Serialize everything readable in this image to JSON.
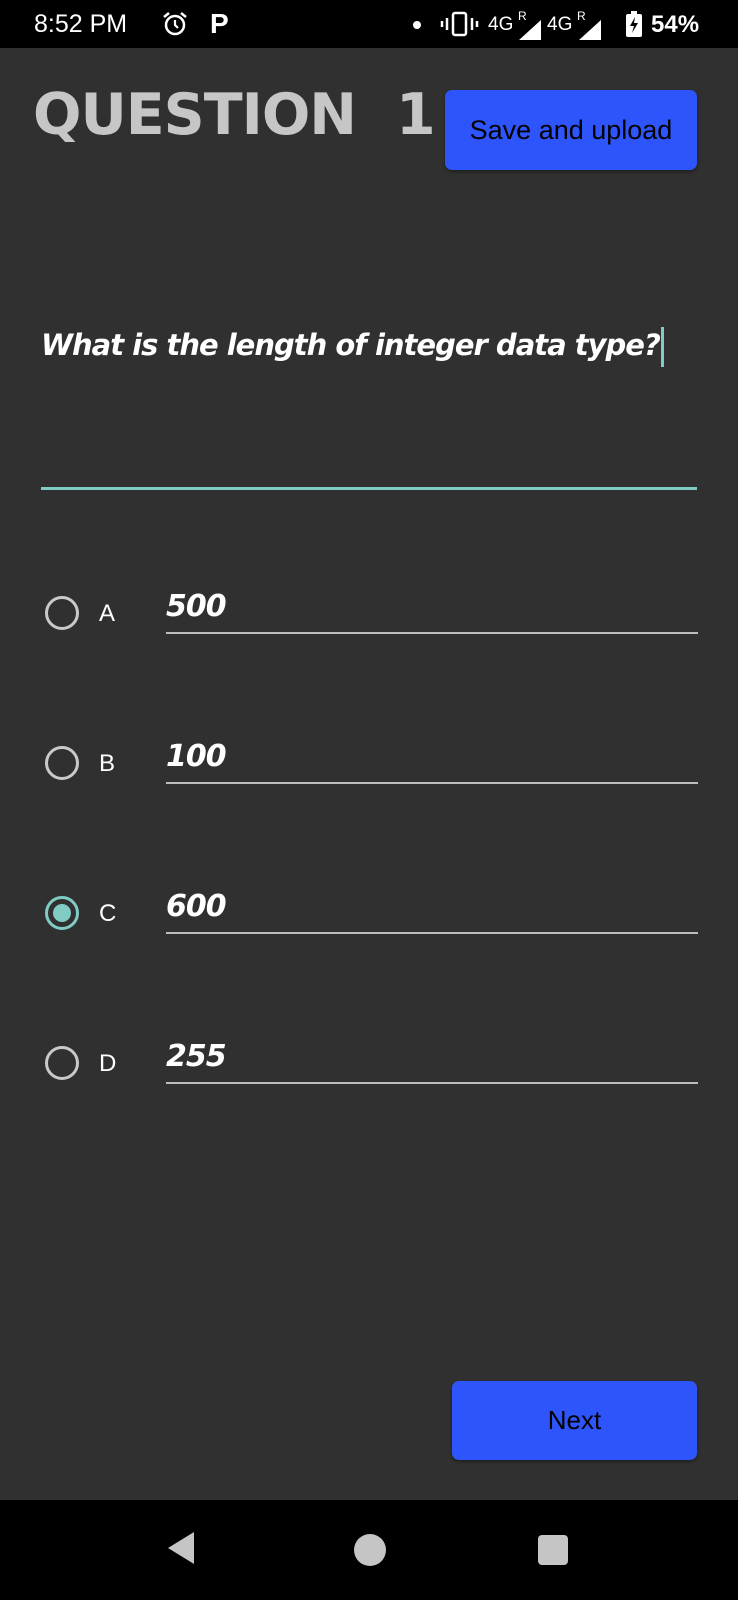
{
  "status_bar": {
    "time": "8:52 PM",
    "p_label": "P",
    "network_1": "4G",
    "roaming_1": "R",
    "network_2": "4G",
    "roaming_2": "R",
    "battery": "54%"
  },
  "header": {
    "title": "QUESTION",
    "number": "1",
    "upload_label": "Save and upload"
  },
  "question": {
    "text": "What is the length of integer data type?"
  },
  "options": [
    {
      "letter": "A",
      "value": "500",
      "selected": false
    },
    {
      "letter": "B",
      "value": "100",
      "selected": false
    },
    {
      "letter": "C",
      "value": "600",
      "selected": true
    },
    {
      "letter": "D",
      "value": "255",
      "selected": false
    }
  ],
  "footer": {
    "next_label": "Next"
  },
  "colors": {
    "background": "#303030",
    "button": "#2e54fb",
    "accent": "#80cbc4"
  },
  "icons": {
    "alarm": "alarm-icon",
    "vibrate": "vibrate-icon",
    "signal": "signal-icon",
    "battery": "battery-charging-icon",
    "back": "back-triangle-icon",
    "home": "home-circle-icon",
    "recents": "recents-square-icon"
  }
}
